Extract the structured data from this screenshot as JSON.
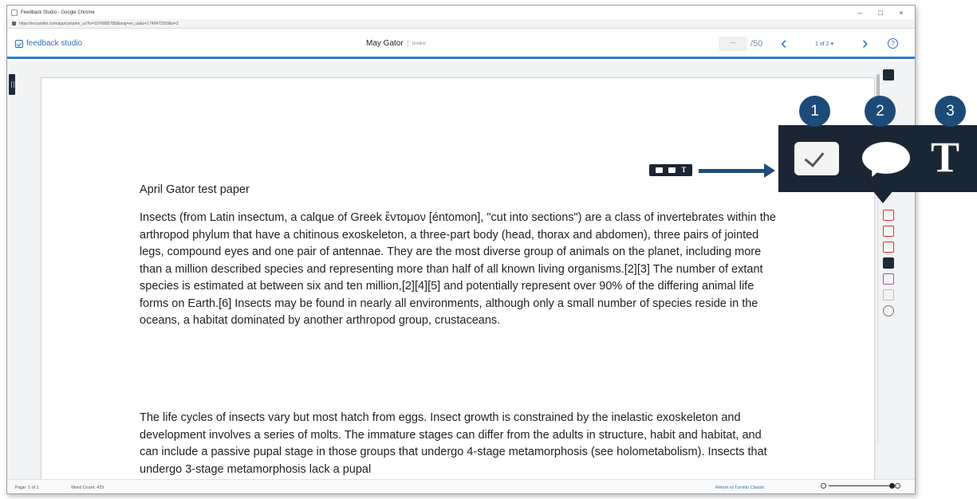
{
  "window": {
    "tab_title": "Feedback Studio - Google Chrome",
    "url": "https://ev.turnitin.com/app/carta/en_us?lo=1076885785&lang=en_us&o=1749472259&s=3",
    "controls": [
      "–",
      "□",
      "×"
    ]
  },
  "header": {
    "brand": "feedback studio",
    "student_name": "May Gator",
    "paper_status": "Untitled",
    "grade_value": "---",
    "grade_max": "/50",
    "prev_icon": "‹",
    "next_icon": "›",
    "paper_count": "1 of 2 ▾",
    "help_icon": "?"
  },
  "paper": {
    "title": "April Gator test paper",
    "paragraph1": "Insects (from Latin insectum, a calque of Greek ἔντομον [éntomon], \"cut into sections\") are a class of invertebrates within the arthropod phylum that have a chitinous exoskeleton, a three-part body (head, thorax and abdomen), three pairs of jointed legs, compound eyes and one pair of antennae. They are the most diverse group of animals on the planet, including more than a million described species and representing more than half of all known living organisms.[2][3] The number of extant species is estimated at between six and ten million,[2][4][5] and potentially represent over 90% of the differing animal life forms on Earth.[6] Insects may be found in nearly all environments, although only a small number of species reside in the oceans, a habitat dominated by another arthropod group, crustaceans.",
    "paragraph2": "The life cycles of insects vary but most hatch from eggs. Insect growth is constrained by the inelastic exoskeleton and development involves a series of molts. The immature stages can differ from the adults in structure, habit and habitat, and can include a passive pupal stage in those groups that undergo 4-stage metamorphosis (see holometabolism). Insects that undergo 3-stage metamorphosis lack a pupal"
  },
  "mini_toolbar": {
    "text_tool": "T"
  },
  "callout": {
    "badges": [
      "1",
      "2",
      "3"
    ],
    "text_tool_glyph": "T",
    "icons": [
      "checkmark-icon",
      "comment-bubble-icon",
      "text-comment-icon"
    ]
  },
  "statusbar": {
    "page": "Page: 1 of 1",
    "word_count": "Word Count: 425",
    "return_link": "Return to Turnitin Classic"
  },
  "colors": {
    "accent": "#2b7bd0",
    "callout_bg": "#1b2635",
    "badge": "#1c4b78",
    "arrow": "#1f4e79"
  }
}
